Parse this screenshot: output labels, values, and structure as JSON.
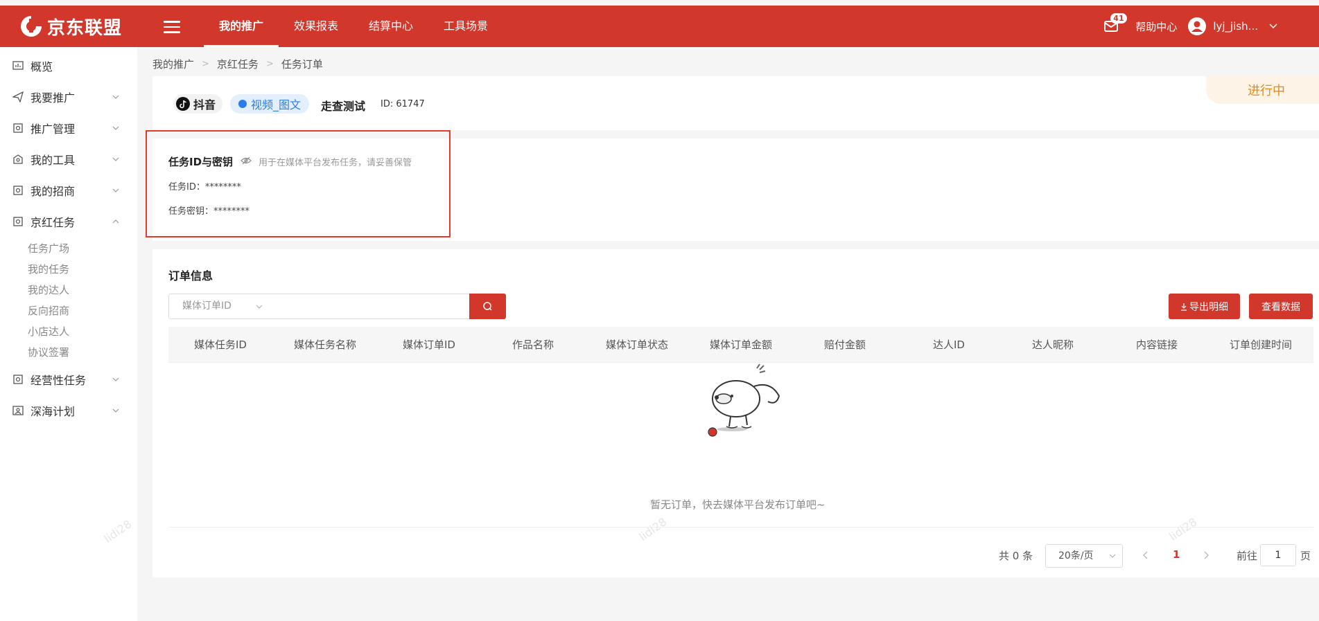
{
  "header": {
    "logo_text": "京东联盟",
    "nav": [
      {
        "label": "我的推广",
        "active": true
      },
      {
        "label": "效果报表"
      },
      {
        "label": "结算中心"
      },
      {
        "label": "工具场景"
      }
    ],
    "notification_count": "41",
    "help_label": "帮助中心",
    "username": "lyj_jish..."
  },
  "sidebar": {
    "items": [
      {
        "label": "概览",
        "icon": "chart-icon"
      },
      {
        "label": "我要推广",
        "icon": "send-icon"
      },
      {
        "label": "推广管理",
        "icon": "doc-icon"
      },
      {
        "label": "我的工具",
        "icon": "tool-icon"
      },
      {
        "label": "我的招商",
        "icon": "doc-icon"
      },
      {
        "label": "京红任务",
        "icon": "doc-icon",
        "expanded": true
      },
      {
        "label": "经营性任务",
        "icon": "doc-icon"
      },
      {
        "label": "深海计划",
        "icon": "person-icon"
      }
    ],
    "sub_items": [
      "任务广场",
      "我的任务",
      "我的达人",
      "反向招商",
      "小店达人",
      "协议签署"
    ],
    "watermark": "lidi28"
  },
  "breadcrumb": [
    "我的推广",
    "京红任务",
    "任务订单"
  ],
  "task": {
    "platform": "抖音",
    "type": "视频_图文",
    "name": "走查测试",
    "id_label": "ID: 61747",
    "status": "进行中"
  },
  "keys": {
    "title": "任务ID与密钥",
    "hint": "用于在媒体平台发布任务，请妥善保管",
    "task_id": "任务ID：********",
    "task_secret": "任务密钥：********"
  },
  "orders": {
    "title": "订单信息",
    "filter_select": "媒体订单ID",
    "search_value": "",
    "export_label": "导出明细",
    "view_data_label": "查看数据",
    "columns": [
      "媒体任务ID",
      "媒体任务名称",
      "媒体订单ID",
      "作品名称",
      "媒体订单状态",
      "媒体订单金额",
      "赔付金额",
      "达人ID",
      "达人昵称",
      "内容链接",
      "订单创建时间"
    ],
    "rows": [],
    "empty_text": "暂无订单，快去媒体平台发布订单吧~"
  },
  "pagination": {
    "total": "共 0 条",
    "page_size": "20条/页",
    "current_page": "1",
    "goto_label": "前往",
    "goto_value": "1",
    "page_suffix": "页"
  },
  "colors": {
    "brand": "#d2372b",
    "accent_blue": "#2b7de9",
    "status_orange": "#e88a1a"
  }
}
